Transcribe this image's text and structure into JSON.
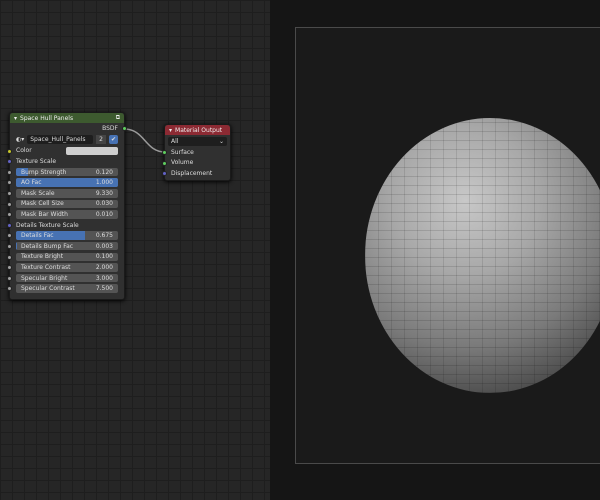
{
  "group_node": {
    "title": "Space Hull Panels",
    "output": "BSDF",
    "datablock": "Space_Hull_Panels",
    "users": "2",
    "color_label": "Color",
    "texture_scale_label": "Texture Scale",
    "details_texture_scale_label": "Details Texture Scale",
    "inputs": [
      {
        "label": "Bump Strength",
        "value": "0.120",
        "fraction": 0.12
      },
      {
        "label": "AO Fac",
        "value": "1.000",
        "fraction": 1.0
      },
      {
        "label": "Mask Scale",
        "value": "9.330"
      },
      {
        "label": "Mask Cell Size",
        "value": "0.030"
      },
      {
        "label": "Mask Bar Width",
        "value": "0.010"
      }
    ],
    "inputs2": [
      {
        "label": "Details Fac",
        "value": "0.675",
        "fraction": 0.675
      },
      {
        "label": "Details Bump Fac",
        "value": "0.003",
        "fraction": 0.003
      },
      {
        "label": "Texture Bright",
        "value": "0.100"
      },
      {
        "label": "Texture Contrast",
        "value": "2.000"
      },
      {
        "label": "Specular Bright",
        "value": "3.000"
      },
      {
        "label": "Specular Contrast",
        "value": "7.500"
      }
    ]
  },
  "output_node": {
    "title": "Material Output",
    "target": "All",
    "sockets": [
      "Surface",
      "Volume",
      "Displacement"
    ]
  },
  "colors": {
    "group_header": "#3d5a2f",
    "output_header": "#8c2a33",
    "accent": "#4772b3"
  }
}
